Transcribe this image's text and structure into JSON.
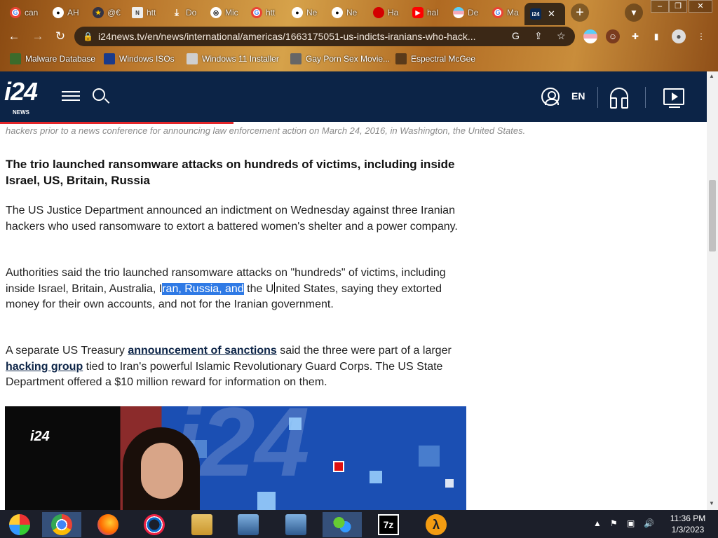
{
  "browser": {
    "tabs": [
      {
        "icon": "google-icon",
        "label": "can"
      },
      {
        "icon": "github-icon",
        "label": "AH"
      },
      {
        "icon": "seal-icon",
        "label": "@€"
      },
      {
        "icon": "news-icon",
        "label": "htt"
      },
      {
        "icon": "download-icon",
        "label": "Do"
      },
      {
        "icon": "globe-icon",
        "label": "Mic"
      },
      {
        "icon": "google-icon",
        "label": "htt"
      },
      {
        "icon": "github-icon",
        "label": "Ne"
      },
      {
        "icon": "github-icon",
        "label": "Ne"
      },
      {
        "icon": "red-icon",
        "label": "Ha"
      },
      {
        "icon": "youtube-icon",
        "label": "hal"
      },
      {
        "icon": "flag-icon",
        "label": "De"
      },
      {
        "icon": "google-icon",
        "label": "Ma"
      },
      {
        "icon": "i24-icon",
        "label": "",
        "active": true
      }
    ],
    "url": "i24news.tv/en/news/international/americas/1663175051-us-indicts-iranians-who-hack...",
    "bookmarks": [
      "Malware Database",
      "Windows ISOs",
      "Windows 11 Installer",
      "Gay Porn Sex Movie...",
      "Espectral McGee"
    ],
    "window_controls": [
      "–",
      "❐",
      "✕"
    ]
  },
  "site": {
    "logo": "i24",
    "logo_sub": "NEWS",
    "lang": "EN"
  },
  "article": {
    "caption": "hackers prior to a news conference for announcing law enforcement action on March 24, 2016, in Washington, the United States.",
    "subheading": "The trio launched ransomware attacks on hundreds of victims, including inside Israel, US, Britain, Russia",
    "p1": "The US Justice Department announced an indictment on Wednesday against three Iranian hackers who used ransomware to extort a battered women's shelter and a power company.",
    "p2_before": "Authorities said the trio launched ransomware attacks on \"hundreds\" of victims, including inside Israel, Britain, Australia, I",
    "p2_selected": "ran, Russia, and",
    "p2_mid": " the U",
    "p2_after": "nited States, saying they extorted money for their own accounts, and not for the Iranian government.",
    "p3_a": "A separate US Treasury ",
    "p3_link1": "announcement of sanctions",
    "p3_b": " said the three were part of a larger ",
    "p3_link2": "hacking group",
    "p3_c": " tied to Iran's powerful Islamic Revolutionary Guard Corps. The US State Department offered a $10 million reward for information on them.",
    "video_logo": "i24",
    "video_logo_sub": "NEWS"
  },
  "reading_progress": 0.33,
  "taskbar": {
    "apps": [
      "multimedia-icon",
      "chrome-icon",
      "firefox-icon",
      "opera-icon",
      "file-explorer-icon",
      "network-setup-icon",
      "network-setup-icon-2",
      "chat-icon",
      "7zip-icon",
      "half-life-icon"
    ],
    "time": "11:36 PM",
    "date": "1/3/2023"
  },
  "colors": {
    "header": "#0c2447",
    "accent": "#e3262a",
    "selection": "#2f7ae5"
  }
}
